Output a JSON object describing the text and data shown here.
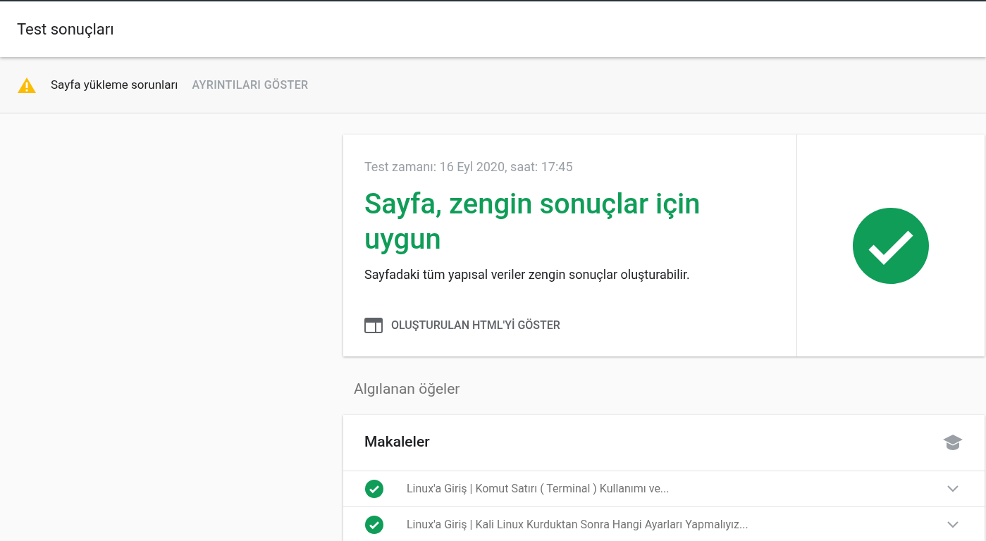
{
  "header": {
    "title": "Test sonuçları"
  },
  "warning": {
    "text": "Sayfa yükleme sorunları",
    "action": "AYRINTILARI GÖSTER"
  },
  "result": {
    "time": "Test zamanı: 16 Eyl 2020, saat: 17:45",
    "headline": "Sayfa, zengin sonuçlar için uygun",
    "description": "Sayfadaki tüm yapısal veriler zengin sonuçlar oluşturabilir.",
    "action": "OLUŞTURULAN HTML'Yİ GÖSTER",
    "valid": true
  },
  "detected": {
    "heading": "Algılanan öğeler",
    "card_title": "Makaleler",
    "items": [
      {
        "label": "Linux'a Giriş | Komut Satırı ( Terminal ) Kullanımı ve...",
        "valid": true,
        "expanded": false
      },
      {
        "label": "Linux'a Giriş | Kali Linux Kurduktan Sonra Hangi Ayarları Yapmalıyız...",
        "valid": true,
        "expanded": false
      }
    ]
  }
}
